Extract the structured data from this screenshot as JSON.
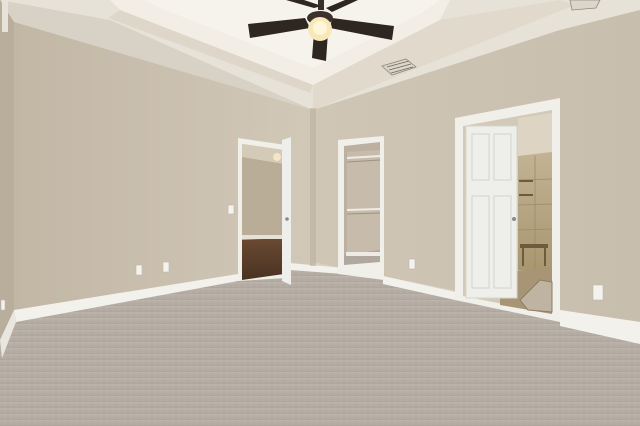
{
  "scene": {
    "room": "empty-bedroom",
    "colors": {
      "wall": "#c9bfaf",
      "wall_shadow": "#b8ad9c",
      "ceiling": "#ebe6dc",
      "carpet": "#b7aea6",
      "trim": "#f3f1ec",
      "door": "#eeeeea",
      "hardwood": "#5b3f2c",
      "fan_blade": "#2e2620",
      "tile": "#b9a889"
    },
    "icons": [
      "ceiling-fan-icon",
      "air-vent-icon",
      "outlet-icon",
      "door-knob-icon"
    ]
  }
}
